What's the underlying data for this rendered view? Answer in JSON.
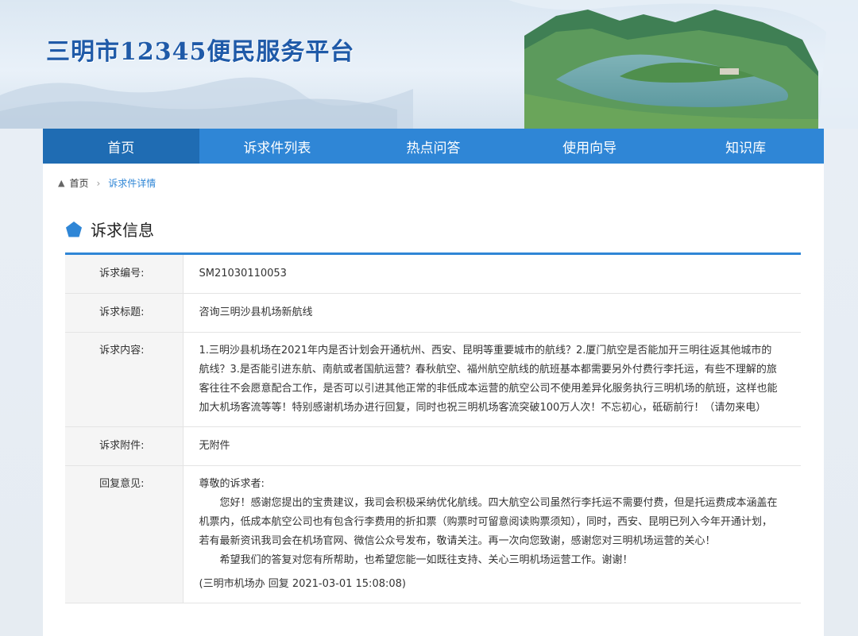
{
  "header": {
    "site_title": "三明市12345便民服务平台"
  },
  "nav": {
    "items": [
      {
        "label": "首页",
        "active": true
      },
      {
        "label": "诉求件列表",
        "active": false
      },
      {
        "label": "热点问答",
        "active": false
      },
      {
        "label": "使用向导",
        "active": false
      },
      {
        "label": "知识库",
        "active": false
      }
    ]
  },
  "breadcrumb": {
    "home": "首页",
    "current": "诉求件详情"
  },
  "section": {
    "title": "诉求信息"
  },
  "complaint": {
    "id_label": "诉求编号:",
    "id_value": "SM21030110053",
    "title_label": "诉求标题:",
    "title_value": "咨询三明沙县机场新航线",
    "content_label": "诉求内容:",
    "content_value": "1.三明沙县机场在2021年内是否计划会开通杭州、西安、昆明等重要城市的航线？2.厦门航空是否能加开三明往返其他城市的航线？3.是否能引进东航、南航或者国航运营？春秋航空、福州航空航线的航班基本都需要另外付费行李托运，有些不理解的旅客往往不会愿意配合工作，是否可以引进其他正常的非低成本运营的航空公司不使用差异化服务执行三明机场的航班，这样也能加大机场客流等等！特别感谢机场办进行回复，同时也祝三明机场客流突破100万人次！不忘初心，砥砺前行！（请勿来电）",
    "attachment_label": "诉求附件:",
    "attachment_value": "无附件",
    "reply_label": "回复意见:",
    "reply_greeting": "尊敬的诉求者:",
    "reply_para1": "您好！感谢您提出的宝贵建议，我司会积极采纳优化航线。四大航空公司虽然行李托运不需要付费，但是托运费成本涵盖在机票内，低成本航空公司也有包含行李费用的折扣票（购票时可留意阅读购票须知），同时，西安、昆明已列入今年开通计划，若有最新资讯我司会在机场官网、微信公众号发布，敬请关注。再一次向您致谢，感谢您对三明机场运营的关心！",
    "reply_para2": "希望我们的答复对您有所帮助，也希望您能一如既往支持、关心三明机场运营工作。谢谢！",
    "reply_meta": "(三明市机场办 回复 2021-03-01 15:08:08)"
  },
  "colors": {
    "nav_bg": "#2f86d6",
    "nav_active": "#1f6cb3",
    "title_blue": "#1f5aa8",
    "accent": "#2f86d6"
  },
  "icons": [
    "home-icon",
    "chevron-right-icon",
    "pentagon-icon"
  ]
}
